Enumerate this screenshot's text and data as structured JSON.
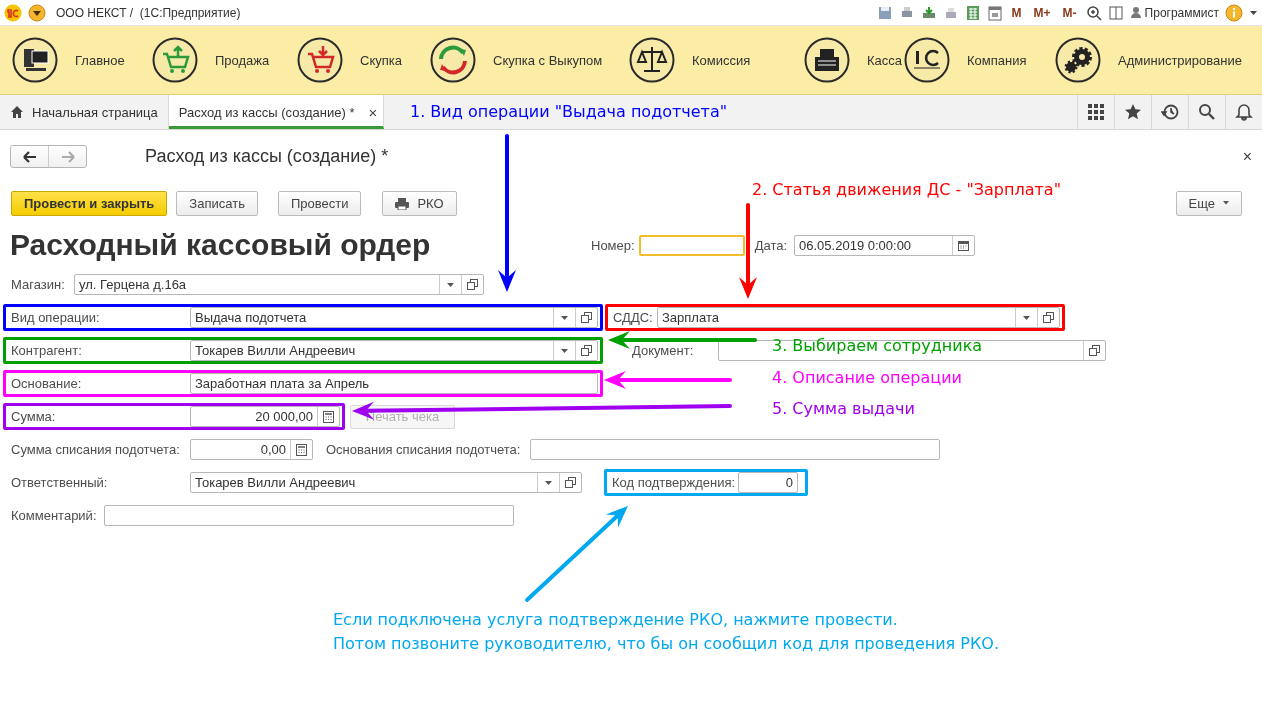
{
  "header": {
    "title": "ООО НЕКСТ /  (1С:Предприятие)",
    "memory_buttons": [
      "M",
      "M+",
      "M-"
    ],
    "user": "Программист"
  },
  "sections": [
    {
      "label": "Главное",
      "kind": "computer"
    },
    {
      "label": "Продажа",
      "kind": "cart_up"
    },
    {
      "label": "Скупка",
      "kind": "cart_down"
    },
    {
      "label": "Скупка с Выкупом",
      "kind": "cycle"
    },
    {
      "label": "Комиссия",
      "kind": "scales"
    },
    {
      "label": "Касса",
      "kind": "register"
    },
    {
      "label": "Компания",
      "kind": "emblem"
    },
    {
      "label": "Администрирование",
      "kind": "gears"
    }
  ],
  "tabs": [
    {
      "label": "Начальная страница",
      "kind": "home",
      "selected": false
    },
    {
      "label": "Расход из кассы (создание) *",
      "kind": "document",
      "selected": true,
      "close": "×"
    }
  ],
  "window": {
    "title": "Расход из кассы (создание) *",
    "close": "×"
  },
  "commands": [
    {
      "label": "Провести и закрыть",
      "kind": "default"
    },
    {
      "label": "Записать",
      "kind": "plain"
    },
    {
      "label": "Провести",
      "kind": "plain"
    },
    {
      "label": "РКО",
      "kind": "print"
    }
  ],
  "more_button": "Еще",
  "form": {
    "title": "Расходный кассовый ордер",
    "number": {
      "label": "Номер:",
      "focused": true
    },
    "date": {
      "label": "Дата:",
      "value": "06.05.2019  0:00:00"
    },
    "rows": [
      {
        "items": [
          {
            "kind": "select",
            "label": "Магазин:",
            "value": "ул. Герцена д.16а"
          }
        ]
      },
      {
        "items": [
          {
            "kind": "select",
            "label": "Вид операции:",
            "value": "Выдача подотчета",
            "color": "#0000ff"
          },
          {
            "kind": "select",
            "label": "СДДС:",
            "value": "Зарплата",
            "color": "#ff0000"
          }
        ]
      },
      {
        "items": [
          {
            "kind": "select",
            "label": "Контрагент:",
            "value": "Токарев Вилли Андреевич",
            "color": "#00a000"
          },
          {
            "kind": "reference",
            "label": "Документ:"
          }
        ]
      },
      {
        "items": [
          {
            "kind": "text",
            "label": "Основание:",
            "value": "Заработная плата за Апрель",
            "color": "#ff00ff"
          }
        ]
      },
      {
        "items": [
          {
            "kind": "number",
            "label": "Сумма:",
            "value": "20 000,00",
            "color": "#a000f0"
          },
          {
            "kind": "button",
            "label": "Печать чека",
            "disabled": true
          }
        ]
      },
      {
        "items": [
          {
            "kind": "number",
            "label": "Сумма списания подотчета:",
            "value": "0,00"
          },
          {
            "kind": "text",
            "label": "Основания списания подотчета:"
          }
        ]
      },
      {
        "items": [
          {
            "kind": "select",
            "label": "Ответственный:",
            "value": "Токарев Вилли Андреевич"
          },
          {
            "kind": "integer",
            "label": "Код подтверждения:",
            "value": "0",
            "color": "#00a8f0"
          }
        ]
      },
      {
        "items": [
          {
            "kind": "text",
            "label": "Комментарий:"
          }
        ]
      }
    ]
  },
  "annotations": [
    {
      "kind": "arrow",
      "text": "1. Вид операции \"Выдача подотчета\"",
      "color": "#0000ff"
    },
    {
      "kind": "arrow",
      "text": "2. Статья движения ДС - \"Зарплата\"",
      "color": "#ff0000"
    },
    {
      "kind": "arrow",
      "text": "3. Выбираем сотрудника",
      "color": "#00a000"
    },
    {
      "kind": "arrow",
      "text": "4. Описание операции",
      "color": "#ff00ff"
    },
    {
      "kind": "arrow",
      "text": "5. Сумма выдачи",
      "color": "#a000f0"
    },
    {
      "kind": "note",
      "lines": [
        "Если подключена услуга подтверждение РКО, нажмите провести.",
        "Потом позвоните руководителю, что бы он сообщил код для проведения РКО."
      ],
      "color": "#00a8f0"
    }
  ]
}
